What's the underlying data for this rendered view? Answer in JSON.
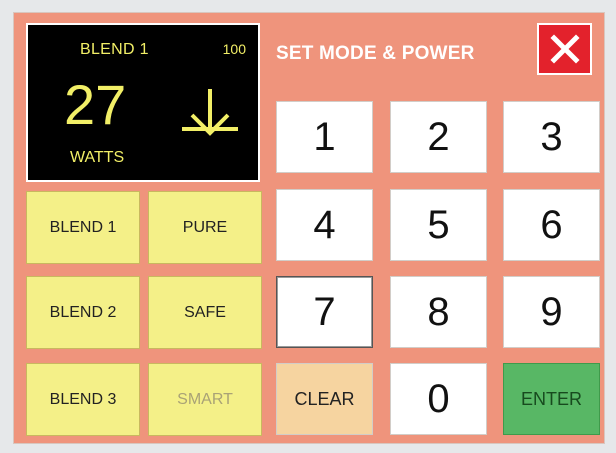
{
  "display": {
    "mode": "BLEND 1",
    "max_power": "100",
    "watts": "27",
    "unit": "WATTS",
    "indicator_icon": "down-arrow-icon"
  },
  "title": "SET MODE & POWER",
  "close_icon": "close-icon",
  "modes": [
    {
      "label": "BLEND 1",
      "enabled": true
    },
    {
      "label": "PURE",
      "enabled": true
    },
    {
      "label": "BLEND 2",
      "enabled": true
    },
    {
      "label": "SAFE",
      "enabled": true
    },
    {
      "label": "BLEND 3",
      "enabled": true
    },
    {
      "label": "SMART",
      "enabled": false
    }
  ],
  "keypad": {
    "k1": "1",
    "k2": "2",
    "k3": "3",
    "k4": "4",
    "k5": "5",
    "k6": "6",
    "k7": "7",
    "k8": "8",
    "k9": "9",
    "k0": "0",
    "clear": "CLEAR",
    "enter": "ENTER"
  },
  "colors": {
    "panel": "#ef947c",
    "display_text": "#f2ef67",
    "close": "#e3222c",
    "enter": "#58b765",
    "clear": "#f6d4a0",
    "mode_button": "#f4f088"
  }
}
